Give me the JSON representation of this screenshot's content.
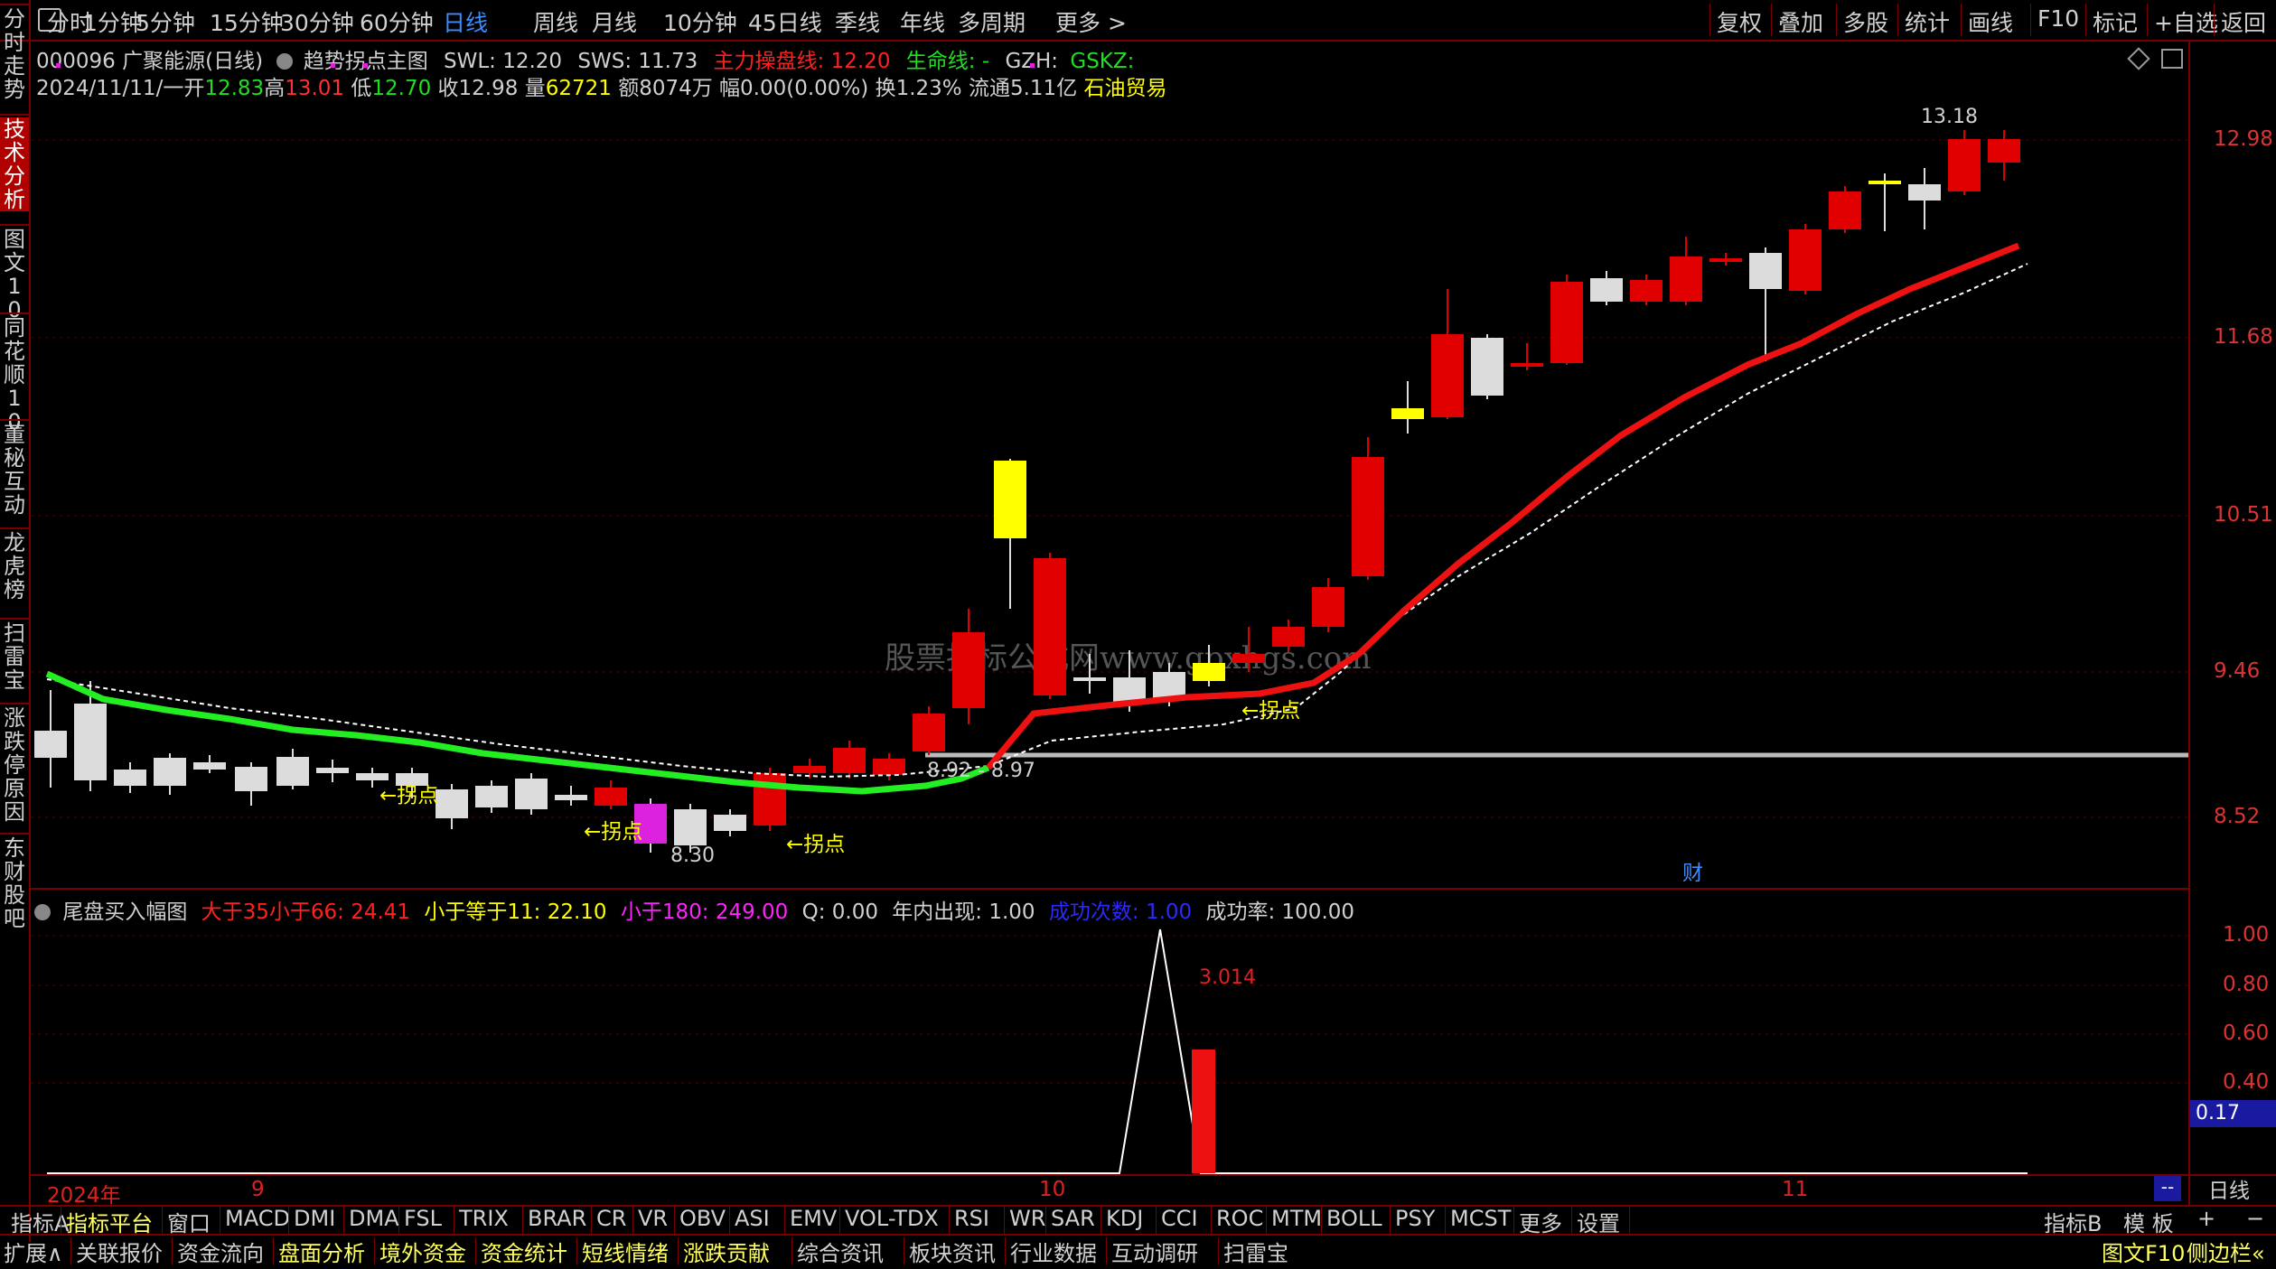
{
  "periods": [
    "分时",
    "1分钟",
    "5分钟",
    "15分钟",
    "30分钟",
    "60分钟",
    "日线",
    "周线",
    "月线",
    "10分钟",
    "45日线",
    "季线",
    "年线",
    "多周期",
    "更多 >"
  ],
  "active_period": "日线",
  "top_right": [
    "复权",
    "叠加",
    "多股",
    "统计",
    "画线",
    "F10",
    "标记",
    "+自选",
    "返回"
  ],
  "left_tabs": [
    "分时走势",
    "技术分析",
    "图文10",
    "同花顺10",
    "董秘互动",
    "龙虎榜",
    "扫雷宝",
    "涨跌停原因",
    "东财股吧"
  ],
  "header": {
    "stock": "000096 广聚能源(日线)",
    "indicator_name": "趋势拐点主图",
    "swl": "SWL: 12.20",
    "sws": "SWS: 11.73",
    "zhuli": "主力操盘线: 12.20",
    "shengming": "生命线: -",
    "gzh": "GZH:",
    "gskz": "GSKZ:"
  },
  "quote": {
    "date": "2024/11/11/一",
    "open_label": "开",
    "open": "12.83",
    "high_label": "高",
    "high": "13.01",
    "low_label": "低",
    "low": "12.70",
    "close_label": "收",
    "close": "12.98",
    "vol_label": "量",
    "vol": "62721",
    "amount": "额8074万",
    "change": "幅0.00(0.00%)",
    "turnover": "换1.23%",
    "float": "流通5.11亿",
    "industry": "石油贸易"
  },
  "price_axis": [
    "12.98",
    "11.68",
    "10.51",
    "9.46",
    "8.52"
  ],
  "annotations": {
    "high_mark": "13.18",
    "low_mark": "8.30",
    "range_label": "8.92 - 8.97",
    "turn": "←拐点",
    "cai": "财",
    "watermark": "股票指标公式网www.gpxhgs.com"
  },
  "sub_header": {
    "name": "尾盘买入幅图",
    "g1": "大于35小于66: 24.41",
    "g2": "小于等于11: 22.10",
    "g3": "小于180: 249.00",
    "q": "Q: 0.00",
    "year": "年内出现: 1.00",
    "succ_count": "成功次数: 1.00",
    "succ_rate": "成功率: 100.00"
  },
  "sub_axis": [
    "1.00",
    "0.80",
    "0.60",
    "0.40"
  ],
  "sub_current": "0.17",
  "sub_value": "3.014",
  "date_axis": [
    "2024年",
    "9",
    "10",
    "11"
  ],
  "date_right": "日线",
  "date_dash": "--",
  "indicator_tabs": [
    "指标A",
    "指标平台",
    "窗口",
    "MACD",
    "DMI",
    "DMA",
    "FSL",
    "TRIX",
    "BRAR",
    "CR",
    "VR",
    "OBV",
    "ASI",
    "EMV",
    "VOL-TDX",
    "RSI",
    "WR",
    "SAR",
    "KDJ",
    "CCI",
    "ROC",
    "MTM",
    "BOLL",
    "PSY",
    "MCST",
    "更多",
    "设置"
  ],
  "indicator_tabs_right": [
    "指标B",
    "模 板",
    "+",
    "−"
  ],
  "bottom_tabs": [
    "扩展∧",
    "关联报价",
    "资金流向",
    "盘面分析",
    "境外资金",
    "资金统计",
    "短线情绪",
    "涨跌贡献",
    "综合资讯",
    "板块资讯",
    "行业数据",
    "互动调研",
    "扫雷宝"
  ],
  "bottom_right": [
    "图文F10",
    "侧边栏«"
  ],
  "colors": {
    "up": "#e00000",
    "down": "#dcdcdc",
    "green": "#22dd22",
    "yellow": "#ffff00",
    "magenta": "#dd22dd"
  }
}
